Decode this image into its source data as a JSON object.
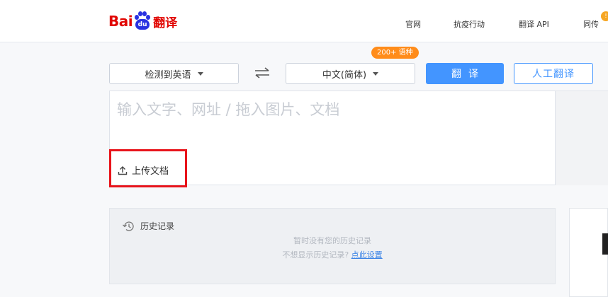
{
  "header": {
    "logo": {
      "bai": "Bai",
      "du": "du",
      "cn": "翻译"
    },
    "nav": [
      {
        "label": "官网"
      },
      {
        "label": "抗疫行动"
      },
      {
        "label": "翻译 API"
      },
      {
        "label": "同传"
      }
    ],
    "nav_badge": "!"
  },
  "toolbar": {
    "source_lang": "检测到英语",
    "target_lang": "中文(简体)",
    "lang_count_badge": "200+ 语种",
    "translate_label": "翻译",
    "human_translate_label": "人工翻译",
    "swap_icon": "swap-arrows-icon"
  },
  "input": {
    "placeholder": "输入文字、网址 / 拖入图片、文档",
    "value": "",
    "upload_label": "上传文档",
    "upload_icon": "upload-icon"
  },
  "history": {
    "title": "历史记录",
    "icon": "history-clock-icon",
    "empty_text": "暂时没有您的历史记录",
    "hint_prefix": "不想显示历史记录?",
    "hint_link": "点此设置"
  },
  "colors": {
    "brand_red": "#e10602",
    "brand_blue": "#2932e1",
    "primary": "#4395ff",
    "badge_orange": "#ff8c1a",
    "highlight_red": "#e8141b"
  }
}
